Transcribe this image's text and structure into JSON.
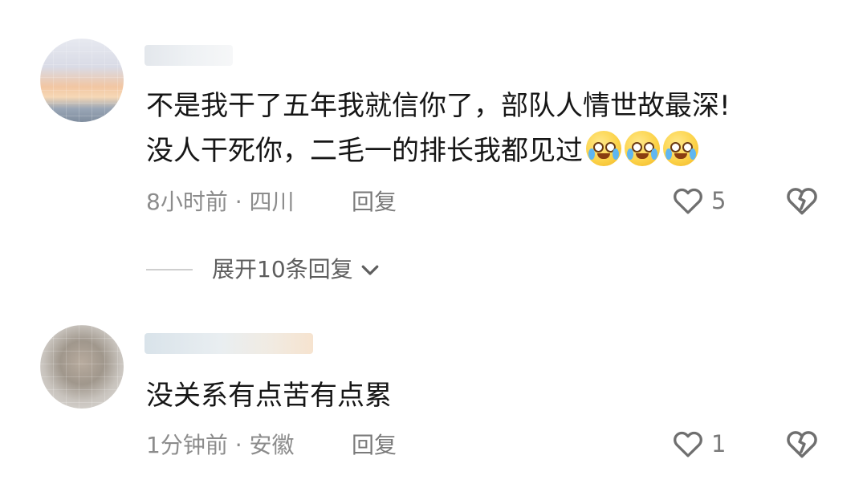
{
  "comments": [
    {
      "text_line1": "不是我干了五年我就信你了，部队人情世故最深!",
      "text_line2": "没人干死你，二毛一的排长我都见过",
      "meta": "8小时前 · 四川",
      "reply_label": "回复",
      "likes": "5",
      "emoji": "crying-face-icon"
    },
    {
      "text": "没关系有点苦有点累",
      "meta": "1分钟前 · 安徽",
      "reply_label": "回复",
      "likes": "1"
    }
  ],
  "expand_replies": {
    "label": "展开10条回复"
  },
  "icons": {
    "like": "heart-outline-icon",
    "dislike": "broken-heart-icon",
    "expand": "chevron-down-icon"
  },
  "colors": {
    "text": "#161616",
    "meta": "#8c8c8c",
    "icon": "#6f6f6f"
  }
}
